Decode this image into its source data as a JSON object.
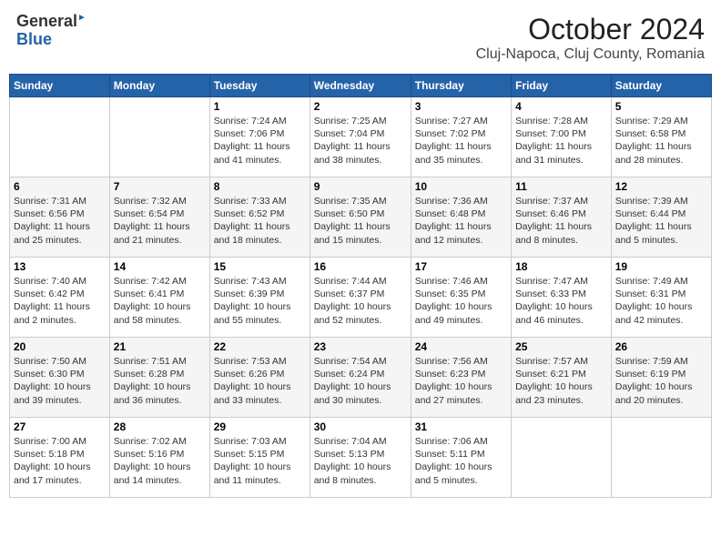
{
  "header": {
    "logo_general": "General",
    "logo_blue": "Blue",
    "title": "October 2024",
    "subtitle": "Cluj-Napoca, Cluj County, Romania"
  },
  "weekdays": [
    "Sunday",
    "Monday",
    "Tuesday",
    "Wednesday",
    "Thursday",
    "Friday",
    "Saturday"
  ],
  "weeks": [
    [
      {
        "num": "",
        "info": ""
      },
      {
        "num": "",
        "info": ""
      },
      {
        "num": "1",
        "info": "Sunrise: 7:24 AM\nSunset: 7:06 PM\nDaylight: 11 hours and 41 minutes."
      },
      {
        "num": "2",
        "info": "Sunrise: 7:25 AM\nSunset: 7:04 PM\nDaylight: 11 hours and 38 minutes."
      },
      {
        "num": "3",
        "info": "Sunrise: 7:27 AM\nSunset: 7:02 PM\nDaylight: 11 hours and 35 minutes."
      },
      {
        "num": "4",
        "info": "Sunrise: 7:28 AM\nSunset: 7:00 PM\nDaylight: 11 hours and 31 minutes."
      },
      {
        "num": "5",
        "info": "Sunrise: 7:29 AM\nSunset: 6:58 PM\nDaylight: 11 hours and 28 minutes."
      }
    ],
    [
      {
        "num": "6",
        "info": "Sunrise: 7:31 AM\nSunset: 6:56 PM\nDaylight: 11 hours and 25 minutes."
      },
      {
        "num": "7",
        "info": "Sunrise: 7:32 AM\nSunset: 6:54 PM\nDaylight: 11 hours and 21 minutes."
      },
      {
        "num": "8",
        "info": "Sunrise: 7:33 AM\nSunset: 6:52 PM\nDaylight: 11 hours and 18 minutes."
      },
      {
        "num": "9",
        "info": "Sunrise: 7:35 AM\nSunset: 6:50 PM\nDaylight: 11 hours and 15 minutes."
      },
      {
        "num": "10",
        "info": "Sunrise: 7:36 AM\nSunset: 6:48 PM\nDaylight: 11 hours and 12 minutes."
      },
      {
        "num": "11",
        "info": "Sunrise: 7:37 AM\nSunset: 6:46 PM\nDaylight: 11 hours and 8 minutes."
      },
      {
        "num": "12",
        "info": "Sunrise: 7:39 AM\nSunset: 6:44 PM\nDaylight: 11 hours and 5 minutes."
      }
    ],
    [
      {
        "num": "13",
        "info": "Sunrise: 7:40 AM\nSunset: 6:42 PM\nDaylight: 11 hours and 2 minutes."
      },
      {
        "num": "14",
        "info": "Sunrise: 7:42 AM\nSunset: 6:41 PM\nDaylight: 10 hours and 58 minutes."
      },
      {
        "num": "15",
        "info": "Sunrise: 7:43 AM\nSunset: 6:39 PM\nDaylight: 10 hours and 55 minutes."
      },
      {
        "num": "16",
        "info": "Sunrise: 7:44 AM\nSunset: 6:37 PM\nDaylight: 10 hours and 52 minutes."
      },
      {
        "num": "17",
        "info": "Sunrise: 7:46 AM\nSunset: 6:35 PM\nDaylight: 10 hours and 49 minutes."
      },
      {
        "num": "18",
        "info": "Sunrise: 7:47 AM\nSunset: 6:33 PM\nDaylight: 10 hours and 46 minutes."
      },
      {
        "num": "19",
        "info": "Sunrise: 7:49 AM\nSunset: 6:31 PM\nDaylight: 10 hours and 42 minutes."
      }
    ],
    [
      {
        "num": "20",
        "info": "Sunrise: 7:50 AM\nSunset: 6:30 PM\nDaylight: 10 hours and 39 minutes."
      },
      {
        "num": "21",
        "info": "Sunrise: 7:51 AM\nSunset: 6:28 PM\nDaylight: 10 hours and 36 minutes."
      },
      {
        "num": "22",
        "info": "Sunrise: 7:53 AM\nSunset: 6:26 PM\nDaylight: 10 hours and 33 minutes."
      },
      {
        "num": "23",
        "info": "Sunrise: 7:54 AM\nSunset: 6:24 PM\nDaylight: 10 hours and 30 minutes."
      },
      {
        "num": "24",
        "info": "Sunrise: 7:56 AM\nSunset: 6:23 PM\nDaylight: 10 hours and 27 minutes."
      },
      {
        "num": "25",
        "info": "Sunrise: 7:57 AM\nSunset: 6:21 PM\nDaylight: 10 hours and 23 minutes."
      },
      {
        "num": "26",
        "info": "Sunrise: 7:59 AM\nSunset: 6:19 PM\nDaylight: 10 hours and 20 minutes."
      }
    ],
    [
      {
        "num": "27",
        "info": "Sunrise: 7:00 AM\nSunset: 5:18 PM\nDaylight: 10 hours and 17 minutes."
      },
      {
        "num": "28",
        "info": "Sunrise: 7:02 AM\nSunset: 5:16 PM\nDaylight: 10 hours and 14 minutes."
      },
      {
        "num": "29",
        "info": "Sunrise: 7:03 AM\nSunset: 5:15 PM\nDaylight: 10 hours and 11 minutes."
      },
      {
        "num": "30",
        "info": "Sunrise: 7:04 AM\nSunset: 5:13 PM\nDaylight: 10 hours and 8 minutes."
      },
      {
        "num": "31",
        "info": "Sunrise: 7:06 AM\nSunset: 5:11 PM\nDaylight: 10 hours and 5 minutes."
      },
      {
        "num": "",
        "info": ""
      },
      {
        "num": "",
        "info": ""
      }
    ]
  ]
}
